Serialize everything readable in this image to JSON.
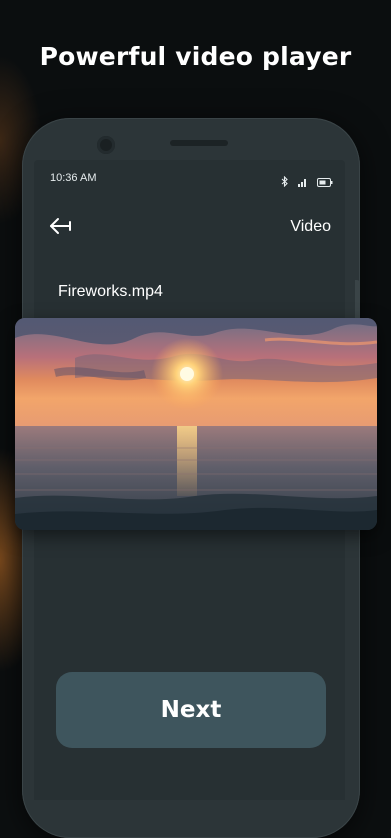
{
  "promo": {
    "title": "Powerful video player"
  },
  "status_bar": {
    "time": "10:36 AM",
    "icons": [
      "bluetooth-icon",
      "signal-icon",
      "battery-icon"
    ]
  },
  "app_bar": {
    "back_icon": "back-arrow-icon",
    "title": "Video"
  },
  "video": {
    "file_name": "Fireworks.mp4",
    "thumbnail": "sunset-over-sea"
  },
  "actions": {
    "next_label": "Next"
  },
  "colors": {
    "accent_button": "#3e555d",
    "screen_bg": "#273033",
    "phone_frame": "#2c3538",
    "text": "#ffffff"
  }
}
